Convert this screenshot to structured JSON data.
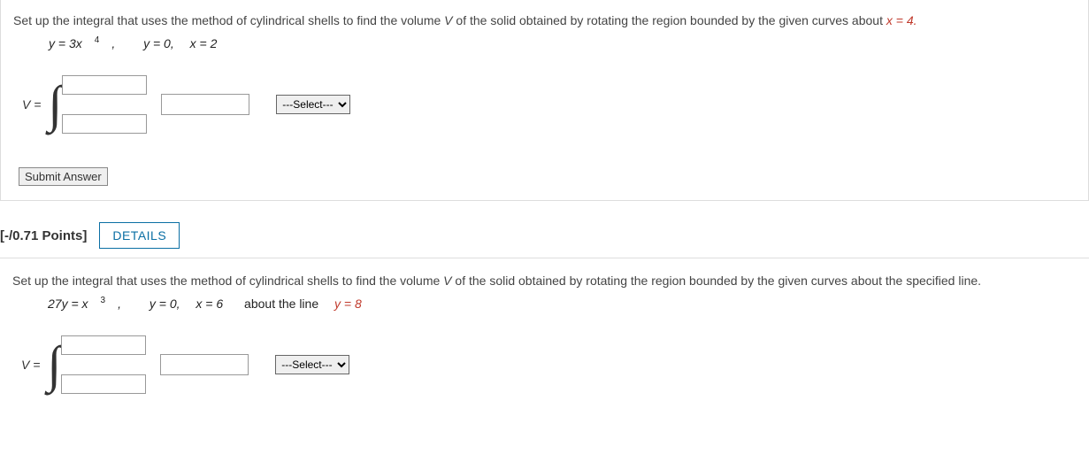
{
  "q1": {
    "prompt_pre": "Set up the integral that uses the method of cylindrical shells to find the volume ",
    "prompt_var": "V",
    "prompt_mid": " of the solid obtained by rotating the region bounded by the given curves about ",
    "prompt_axis": "x = 4.",
    "eq1": "y = 3x",
    "eq1_exp": "4",
    "eq1_comma": ",",
    "eq2": "y = 0,",
    "eq3": "x = 2",
    "v_equals": "V = ",
    "select_placeholder": "---Select---",
    "submit_label": "Submit Answer"
  },
  "header2": {
    "points": "[-/0.71 Points]",
    "details": "DETAILS"
  },
  "q2": {
    "prompt_pre": "Set up the integral that uses the method of cylindrical shells to find the volume ",
    "prompt_var": "V",
    "prompt_mid": " of the solid obtained by rotating the region bounded by the given curves about the specified line.",
    "eq1": "27y = x",
    "eq1_exp": "3",
    "eq1_comma": ",",
    "eq2": "y = 0,",
    "eq3": "x = 6",
    "about": "about the line ",
    "about_line": "y = 8",
    "v_equals": "V = ",
    "select_placeholder": "---Select---"
  }
}
